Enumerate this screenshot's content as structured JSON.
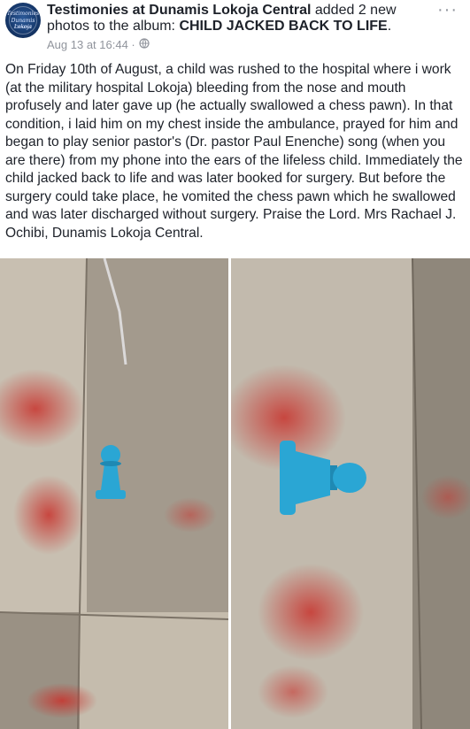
{
  "post": {
    "author": "Testimonies at Dunamis Lokoja Central",
    "action_text": " added 2 new photos to the album: ",
    "album": "CHILD JACKED BACK TO LIFE",
    "period": ".",
    "timestamp": "Aug 13 at 16:44 ·",
    "privacy_icon": "globe-icon",
    "more_label": "···",
    "body": "On Friday 10th of August, a child was rushed to the hospital where i work (at the military hospital Lokoja) bleeding from the nose and mouth profusely and later gave up (he actually swallowed a chess pawn). In that condition, i laid him on my chest inside the ambulance, prayed for him and began to play senior pastor's  (Dr. pastor Paul Enenche) song (when you are there) from my phone into the ears of the lifeless child. Immediately the child jacked back to life and was later booked for surgery. But before the surgery could take place, he vomited the chess pawn which he swallowed and was later discharged without surgery. Praise the Lord. Mrs Rachael J. Ochibi, Dunamis Lokoja Central."
  },
  "avatar": {
    "line1": "Testimonies",
    "line2": "Dunamis Lokoja",
    "line3": "Central"
  },
  "colors": {
    "text": "#1d2129",
    "meta": "#90949c",
    "pawn": "#2aa6d4",
    "blood": "#c8322c"
  }
}
